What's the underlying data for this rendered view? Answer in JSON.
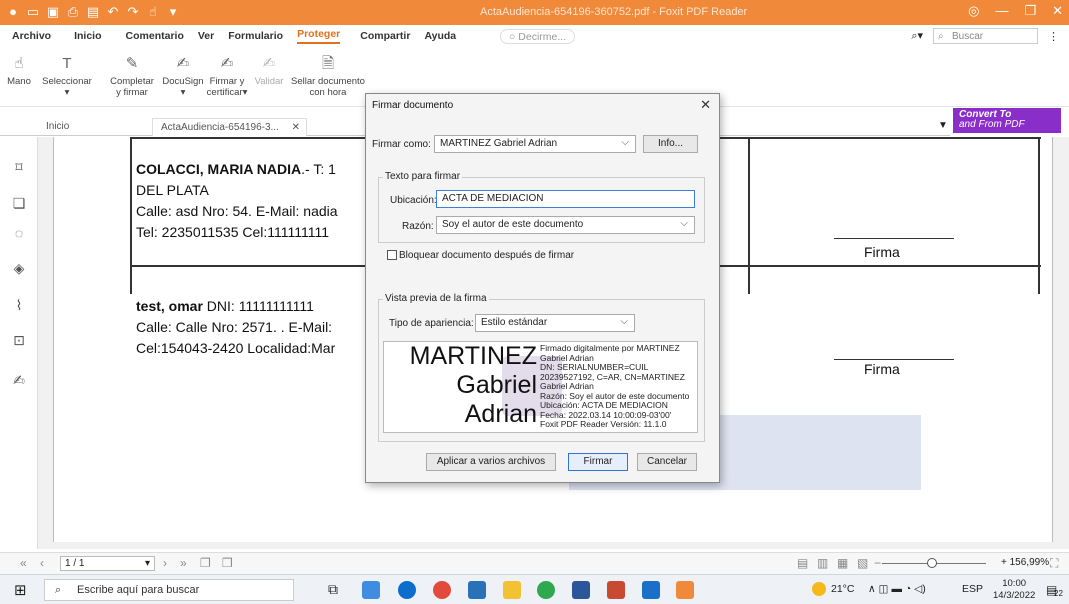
{
  "window": {
    "title": "ActaAudiencia-654196-360752.pdf - Foxit PDF Reader",
    "accent": "#f0893a"
  },
  "menu": {
    "items": [
      "Archivo",
      "Inicio",
      "Comentario",
      "Ver",
      "Formulario",
      "Proteger",
      "Compartir",
      "Ayuda"
    ],
    "active": "Proteger",
    "tellme_placeholder": "Decirme...",
    "search_placeholder": "Buscar"
  },
  "ribbon": {
    "mano": "Mano",
    "seleccionar": "Seleccionar",
    "completar": "Completar",
    "completar2": "y firmar",
    "docusign": "DocuSign",
    "firmar": "Firmar y",
    "firmar2": "certificar",
    "validar": "Validar",
    "sellar": "Sellar documento",
    "sellar2": "con hora"
  },
  "convert": {
    "line1": "Convert To",
    "line2": "and From PDF"
  },
  "tabs": {
    "home": "Inicio",
    "doc": "ActaAudiencia-654196-3..."
  },
  "document": {
    "p1_name": "COLACCI, MARIA NADIA",
    "p1_l1": ".- T: 1",
    "p1_l2": "DEL PLATA",
    "p1_l3": "Calle: asd Nro: 54. E-Mail: nadia",
    "p1_l4": "Tel: 2235011535 Cel:111111111",
    "p2_name": "test, omar",
    "p2_l1": " DNI: 11111111111",
    "p2_l2": "Calle: Calle Nro: 2571. . E-Mail: ",
    "p2_l3": "Cel:154043-2420 Localidad:Mar",
    "firma1": "Firma",
    "firma2": "Firma"
  },
  "dialog": {
    "title": "Firmar documento",
    "firmar_como_label": "Firmar como:",
    "firmar_como_value": "MARTINEZ Gabriel Adrian",
    "info_button": "Info...",
    "texto_group": "Texto para firmar",
    "ubicacion_label": "Ubicación:",
    "ubicacion_value": "ACTA DE MEDIACION",
    "razon_label": "Razón:",
    "razon_value": "Soy el autor de este documento",
    "bloquear_label": "Bloquear documento después de firmar",
    "vista_group": "Vista previa de la firma",
    "tipo_label": "Tipo de apariencia:",
    "tipo_value": "Estilo estándar",
    "preview": {
      "name1": "MARTINEZ",
      "name2": "Gabriel",
      "name3": "Adrian",
      "info": [
        "Firmado digitalmente por MARTINEZ",
        "Gabriel Adrian",
        "DN: SERIALNUMBER=CUIL",
        "20239527192, C=AR, CN=MARTINEZ",
        "Gabriel Adrian",
        "Razón: Soy el autor de este documento",
        "Ubicación: ACTA DE MEDIACION",
        "Fecha: 2022.03.14 10:00:09-03'00'",
        "Foxit PDF Reader Versión: 11.1.0"
      ]
    },
    "aplicar_button": "Aplicar a varios archivos",
    "firmar_button": "Firmar",
    "cancelar_button": "Cancelar"
  },
  "nav": {
    "page": "1 / 1",
    "zoom": "+ 156,99%"
  },
  "taskbar": {
    "search": "Escribe aquí para buscar",
    "weather": "21°C",
    "lang": "ESP",
    "time": "10:00",
    "date": "14/3/2022",
    "badge": "22"
  }
}
